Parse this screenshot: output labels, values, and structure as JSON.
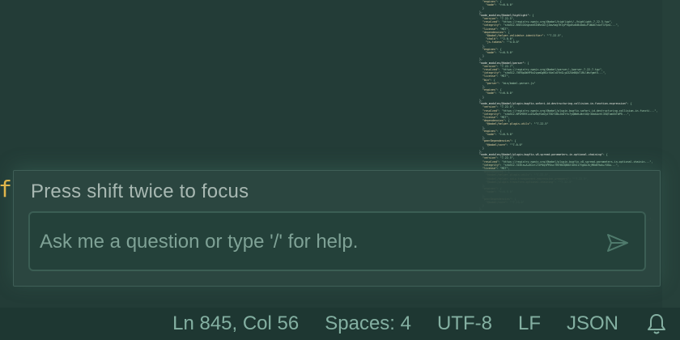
{
  "editor": {
    "gutter_char": "f",
    "minimap_lines": [
      "    \"engines\": {",
      "      \"node\": \">=6.0.0\"",
      "    }",
      "  },",
      "  \"node_modules/@babel/highlight\": {",
      "    \"version\": \"7.22.5\",",
      "    \"resolved\": \"https://registry.npmjs.org/@babel/highlight/-/highlight-7.22.5.tgz\",",
      "    \"integrity\": \"sha512-BSKlD1hgnedS5XRnGOljZawtag7H1yPfQp0sdkBi8aO+P1WA07zAvT1Ypn1...\",",
      "    \"license\": \"MIT\",",
      "    \"dependencies\": {",
      "      \"@babel/helper-validator-identifier\": \"^7.22.5\",",
      "      \"chalk\": \"^2.0.0\",",
      "      \"js-tokens\": \"^4.0.0\"",
      "    },",
      "    \"engines\": {",
      "      \"node\": \">=6.9.0\"",
      "    }",
      "  },",
      "  \"node_modules/@babel/parser\": {",
      "    \"version\": \"7.22.7\",",
      "    \"resolved\": \"https://registry.npmjs.org/@babel/parser/-/parser-7.22.7.tgz\",",
      "    \"integrity\": \"sha512-7NF8pOkHP5o2vpmGgNGcfAeCvOYhGLyA3Z4eBQkT1RLlWsfgmt5...\",",
      "    \"license\": \"MIT\",",
      "    \"bin\": {",
      "      \"parser\": \"bin/babel-parser.js\"",
      "    },",
      "    \"engines\": {",
      "      \"node\": \">=6.0.0\"",
      "    }",
      "  },",
      "  \"node_modules/@babel/plugin-bugfix-safari-id-destructuring-collision-in-function-expression\": {",
      "    \"version\": \"7.22.5\",",
      "    \"resolved\": \"https://registry.npmjs.org/@babel/plugin-bugfix-safari-id-destructuring-collision-in-functi...\",",
      "    \"integrity\": \"sha512-NP1M5Rf+u2Gw9qfSaOyxT5DfIBuJkDYfx7yQWbH+WvtUQr3OakAvhl35QTomXhTbP9...\",",
      "    \"license\": \"MIT\",",
      "    \"dependencies\": {",
      "      \"@babel/helper-plugin-utils\": \"^7.22.5\"",
      "    },",
      "    \"engines\": {",
      "      \"node\": \">=6.9.0\"",
      "    },",
      "    \"peerDependencies\": {",
      "      \"@babel/core\": \"^7.0.0\"",
      "    }",
      "  },",
      "  \"node_modules/@babel/plugin-bugfix-v8-spread-parameters-in-optional-chaining\": {",
      "    \"version\": \"7.22.5\",",
      "    \"resolved\": \"https://registry.npmjs.org/@babel/plugin-bugfix-v8-spread-parameters-in-optional-chainin...\",",
      "    \"integrity\": \"sha512-31Bla+A+8Cor+T2P0qtPR5ucTRE9BZQB8XlDhG17VgDAJkjM8dE9wk+fUGw...\",",
      "    \"license\": \"MIT\",",
      "    \"dependencies\": {",
      "      \"@babel/helper-plugin-utils\": \"^7.22.5\",",
      "      \"@babel/helper-skip-transparent-expression-wrappers\": \"^7.22.5\",",
      "      \"@babel/plugin-transform-optional-chaining\": \"^7.22.5\"",
      "    },",
      "    \"engines\": {",
      "      \"node\": \">=6.9.0\"",
      "    },",
      "    \"peerDependencies\": {",
      "      \"@babel/core\": \"^7.13.0\"",
      "    }",
      "  },",
      "  \"node_modules/@babel/plugin-proposal-async-generator-functions\": {",
      "    \"version\": \"7.20.7\",",
      "    \"resolved\": \"https://registry.npmjs.org/@babel/plugin-proposal-async-generator-functions/-/plugin-pro...\",",
      "    \"integrity\": \"sha512-xMbiLsn/8RK7Wq7VeVytytS2L6qE69bXPB10YCmMdDZbKF4okCqY74pI/jJQ...\",",
      "    \"license\": \"MIT\","
    ]
  },
  "ai_panel": {
    "hint": "Press shift twice to focus",
    "input_placeholder": "Ask me a question or type '/' for help.",
    "send_icon": "send-icon"
  },
  "status_bar": {
    "position": "Ln 845, Col 56",
    "indent": "Spaces: 4",
    "encoding": "UTF-8",
    "line_ending": "LF",
    "language": "JSON",
    "notifications_icon": "bell-icon"
  },
  "colors": {
    "editor_bg": "#233c37",
    "status_bg": "#1e3732",
    "status_text": "#84b0a2",
    "accent_yellow": "#e8b84a",
    "panel_bg": "#2c4841",
    "placeholder": "#7fa296"
  }
}
